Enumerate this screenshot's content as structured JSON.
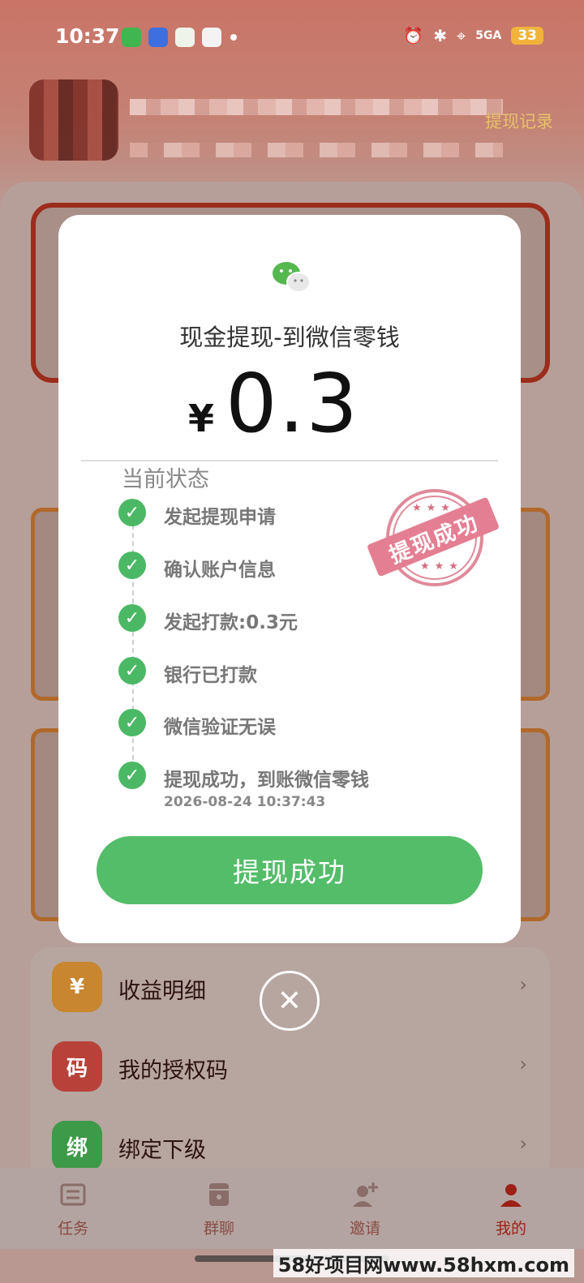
{
  "status_bar": {
    "time": "10:37",
    "battery": "33",
    "network": "5GA"
  },
  "header": {
    "withdraw_record_label": "提现记录"
  },
  "modal": {
    "title": "现金提现-到微信零钱",
    "currency_symbol": "¥",
    "amount": "0.3",
    "status_heading": "当前状态",
    "steps": [
      {
        "label": "发起提现申请"
      },
      {
        "label": "确认账户信息"
      },
      {
        "label": "发起打款:0.3元"
      },
      {
        "label": "银行已打款"
      },
      {
        "label": "微信验证无误"
      },
      {
        "label": "提现成功，到账微信零钱",
        "time": "2026-08-24 10:37:43"
      }
    ],
    "stamp_text": "提现成功",
    "button_label": "提现成功",
    "close_symbol": "✕"
  },
  "menu": {
    "items": [
      {
        "icon_text": "¥",
        "label": "收益明细",
        "color": "#c7862f"
      },
      {
        "icon_text": "码",
        "label": "我的授权码",
        "color": "#b8423a"
      },
      {
        "icon_text": "绑",
        "label": "绑定下级",
        "color": "#3d9a48"
      }
    ]
  },
  "tabs": [
    {
      "label": "任务",
      "icon": "task-icon"
    },
    {
      "label": "群聊",
      "icon": "chat-icon"
    },
    {
      "label": "邀请",
      "icon": "invite-icon"
    },
    {
      "label": "我的",
      "icon": "profile-icon",
      "active": true
    }
  ],
  "watermark": "58好项目网www.58hxm.com"
}
